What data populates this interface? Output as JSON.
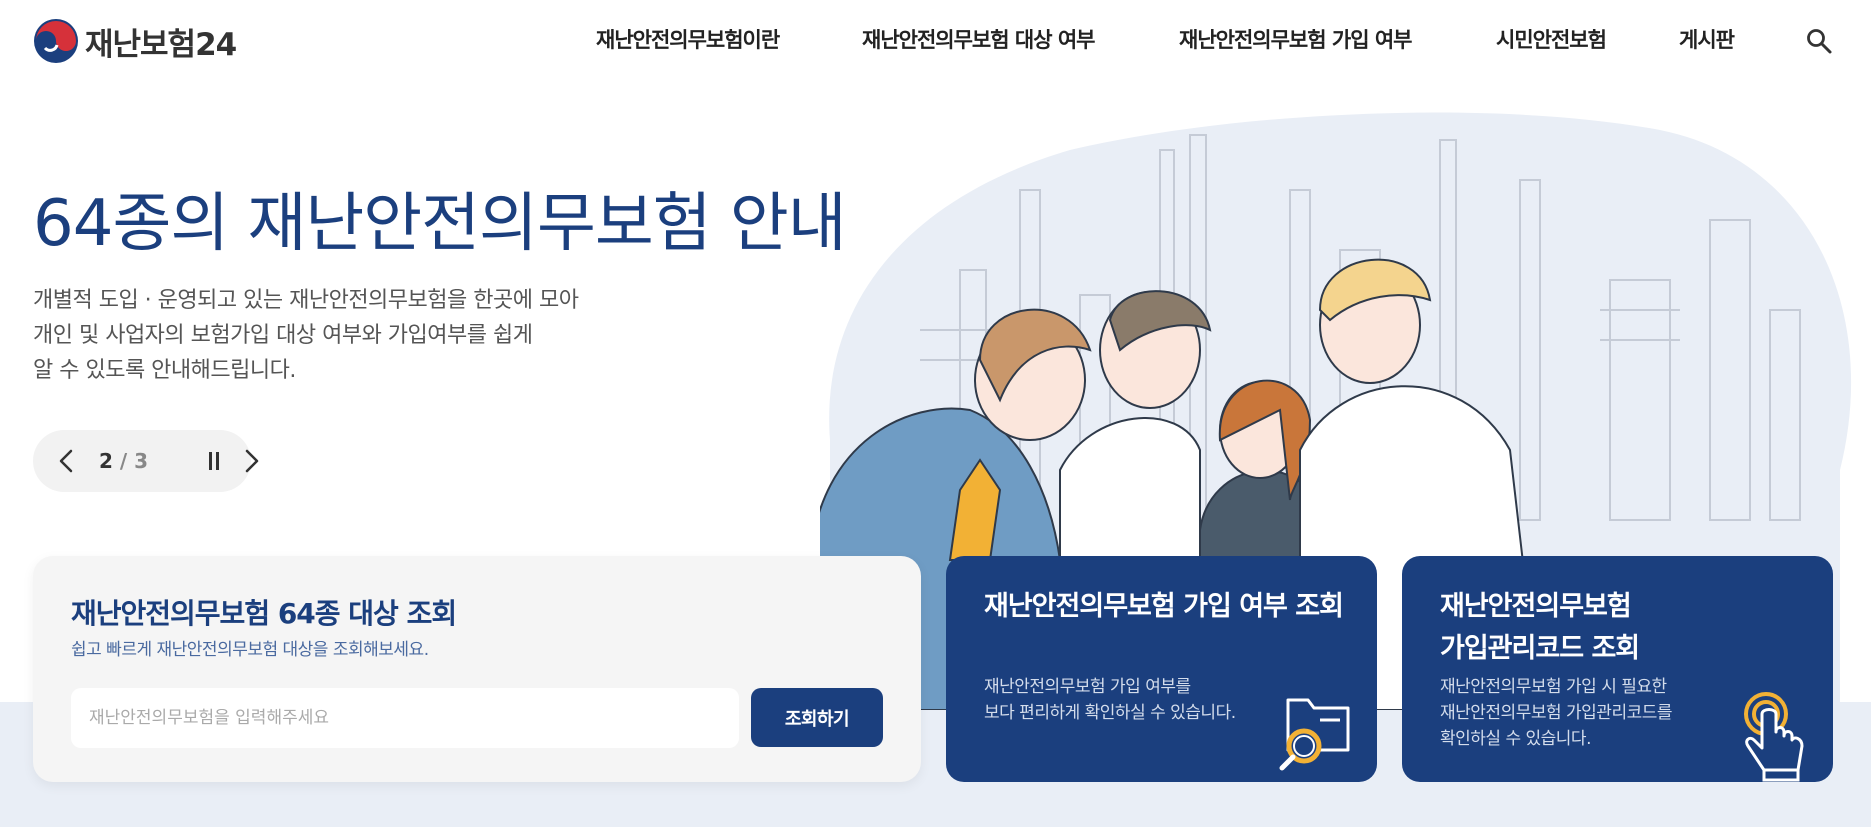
{
  "header": {
    "logo_text": "재난보험24",
    "nav": [
      "재난안전의무보험이란",
      "재난안전의무보험 대상 여부",
      "재난안전의무보험 가입 여부",
      "시민안전보험",
      "게시판"
    ]
  },
  "hero": {
    "title": "64종의 재난안전의무보험 안내",
    "description": [
      "개별적 도입 · 운영되고 있는 재난안전의무보험을 한곳에 모아",
      "개인 및 사업자의 보험가입 대상 여부와 가입여부를 쉽게",
      "알 수 있도록 안내해드립니다."
    ]
  },
  "slider": {
    "current": "2",
    "separator": "/",
    "total": "3"
  },
  "search_card": {
    "title": "재난안전의무보험 64종 대상 조회",
    "subtitle": "쉽고 빠르게 재난안전의무보험 대상을 조회해보세요.",
    "placeholder": "재난안전의무보험을 입력해주세요",
    "value": "",
    "button_label": "조회하기"
  },
  "cards": [
    {
      "title": "재난안전의무보험 가입 여부 조회",
      "description": [
        "재난안전의무보험 가입 여부를",
        "보다 편리하게 확인하실 수 있습니다."
      ],
      "icon": "folder-search-icon"
    },
    {
      "title_lines": [
        "재난안전의무보험",
        "가입관리코드 조회"
      ],
      "description": [
        "재난안전의무보험 가입 시 필요한",
        "재난안전의무보험 가입관리코드를",
        "확인하실 수 있습니다."
      ],
      "icon": "touch-hand-icon"
    }
  ],
  "colors": {
    "primary": "#1b3f7e",
    "accent": "#f2b135",
    "band": "#e9eef6"
  }
}
